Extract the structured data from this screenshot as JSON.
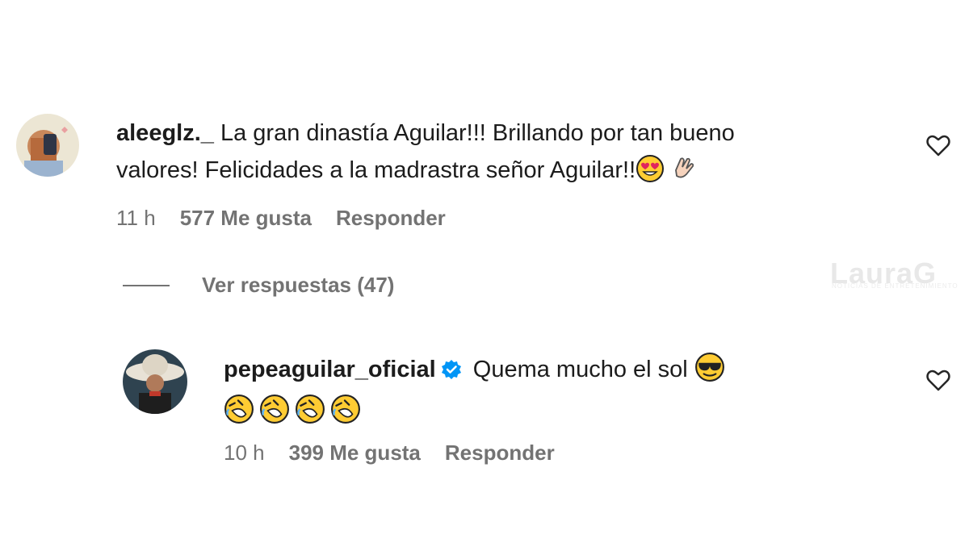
{
  "comments": [
    {
      "username": "aleeglz._",
      "text_line1": "La gran dinastía Aguilar!!! Brillando por tan bueno",
      "text_line2": "valores! Felicidades a la madrastra señor Aguilar!!",
      "emojis": [
        "heart-eyes-emoji",
        "clapping-hand-emoji"
      ],
      "time": "11 h",
      "likes": "577 Me gusta",
      "reply": "Responder"
    },
    {
      "username": "pepeaguilar_oficial",
      "verified": true,
      "text_line1": "Quema mucho el sol",
      "emojis_line1": [
        "sunglasses-emoji"
      ],
      "emojis_line2": [
        "rofl-emoji",
        "rofl-emoji",
        "rofl-emoji",
        "rofl-emoji"
      ],
      "time": "10 h",
      "likes": "399 Me gusta",
      "reply": "Responder"
    }
  ],
  "view_replies": "Ver respuestas (47)",
  "watermark": {
    "title": "LauraG",
    "subtitle": "NOTICIAS DE ENTRETENIMIENTO"
  },
  "colors": {
    "meta": "#737373",
    "verified": "#0095f6",
    "emoji": "#ffcc33"
  }
}
